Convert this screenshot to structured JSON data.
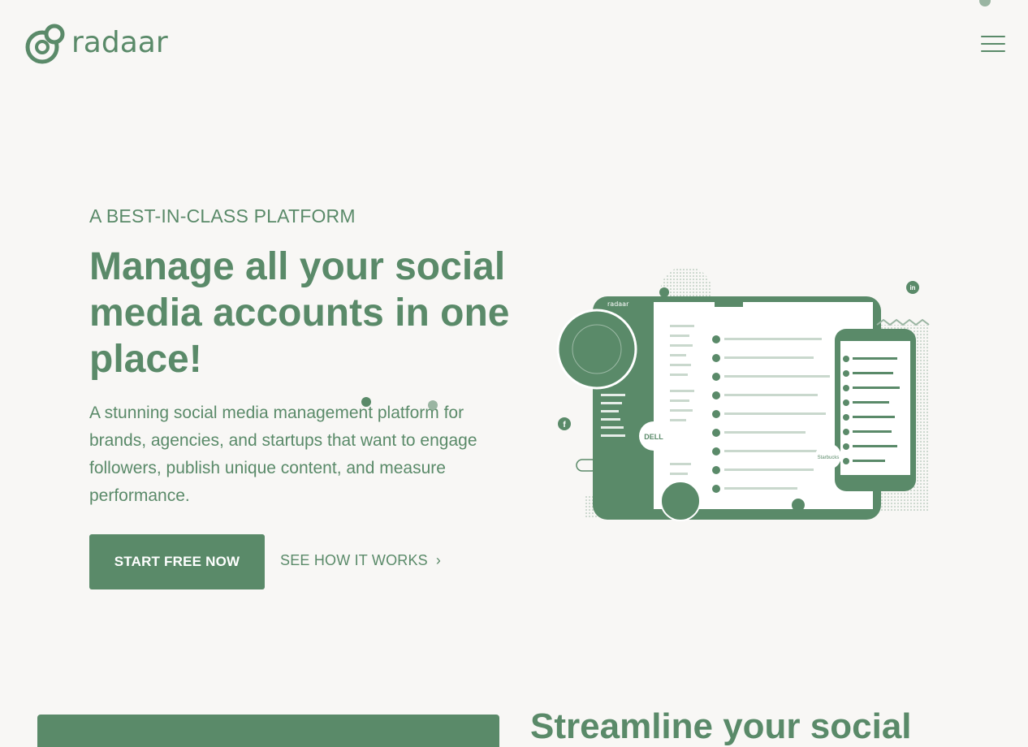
{
  "header": {
    "logo_text": "radaar",
    "menu_icon": "hamburger-menu-icon"
  },
  "hero": {
    "eyebrow": "A BEST-IN-CLASS PLATFORM",
    "title": "Manage all your social media accounts in one place!",
    "subtitle": "A stunning social media management platform for brands, agencies, and startups that want to engage followers, publish unique content, and measure performance.",
    "primary_cta": "START FREE NOW",
    "secondary_cta": "SEE HOW IT WORKS",
    "secondary_cta_icon": "chevron-right-icon"
  },
  "illustration": {
    "app_logo_text": "radaar",
    "brand_badges": [
      "DELL",
      "Starbucks"
    ],
    "social_icons": [
      "linkedin-icon",
      "facebook-icon",
      "twitter-icon"
    ]
  },
  "next_section": {
    "title": "Streamline your social"
  },
  "colors": {
    "brand": "#5a8a69",
    "background": "#f8f7f5"
  }
}
